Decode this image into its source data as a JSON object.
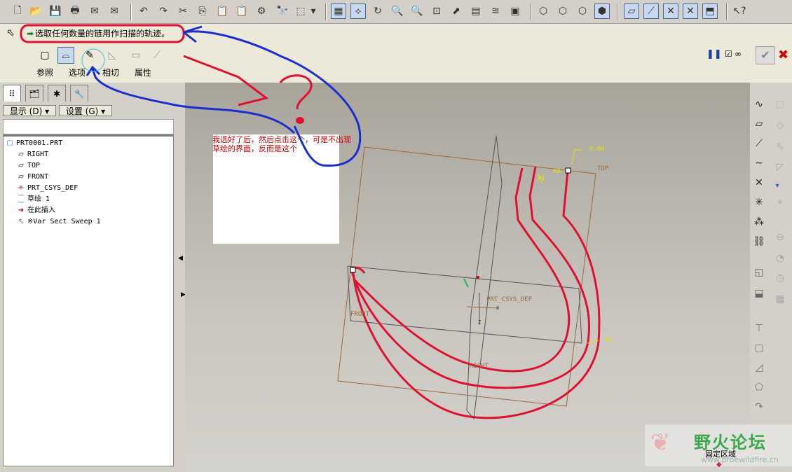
{
  "window": {
    "status_message": "选取任何数量的链用作扫描的轨迹。"
  },
  "dashboard": {
    "tabs": [
      {
        "label": "参照"
      },
      {
        "label": "选项"
      },
      {
        "label": "相切"
      },
      {
        "label": "属性"
      }
    ]
  },
  "left_panel": {
    "display_label": "显示 (D) ▾",
    "settings_label": "设置 (G) ▾",
    "tree": [
      {
        "label": "PRT0001.PRT",
        "icon": "part-icon"
      },
      {
        "label": "RIGHT",
        "icon": "datum-plane-icon"
      },
      {
        "label": "TOP",
        "icon": "datum-plane-icon"
      },
      {
        "label": "FRONT",
        "icon": "datum-plane-icon"
      },
      {
        "label": "PRT_CSYS_DEF",
        "icon": "csys-icon"
      },
      {
        "label": "草绘 1",
        "icon": "sketch-icon"
      },
      {
        "label": "在此插入",
        "icon": "insert-here-icon"
      },
      {
        "label": "※Var Sect Sweep 1",
        "icon": "sweep-icon"
      }
    ]
  },
  "canvas": {
    "annotation": "我选好了后，然后点击这个，可是不出现草绘的界面，反而是这个",
    "labels": {
      "top": "TOP",
      "front": "FRONT",
      "right": "RIGHT",
      "csys": "PRT_CSYS_DEF",
      "dim": "0.00",
      "x_label": "X",
      "z_label": "Z",
      "ma": "MA",
      "m1": "M1",
      "m2": "M2"
    }
  },
  "watermark": {
    "fixed_region": "固定区域",
    "forum_name": "野火论坛",
    "url": "www.proewildfire.cn"
  },
  "colors": {
    "sketch_red": "#e01030",
    "annotation_blue": "#1a2fd0",
    "datum_brown": "#9a6a3a"
  }
}
